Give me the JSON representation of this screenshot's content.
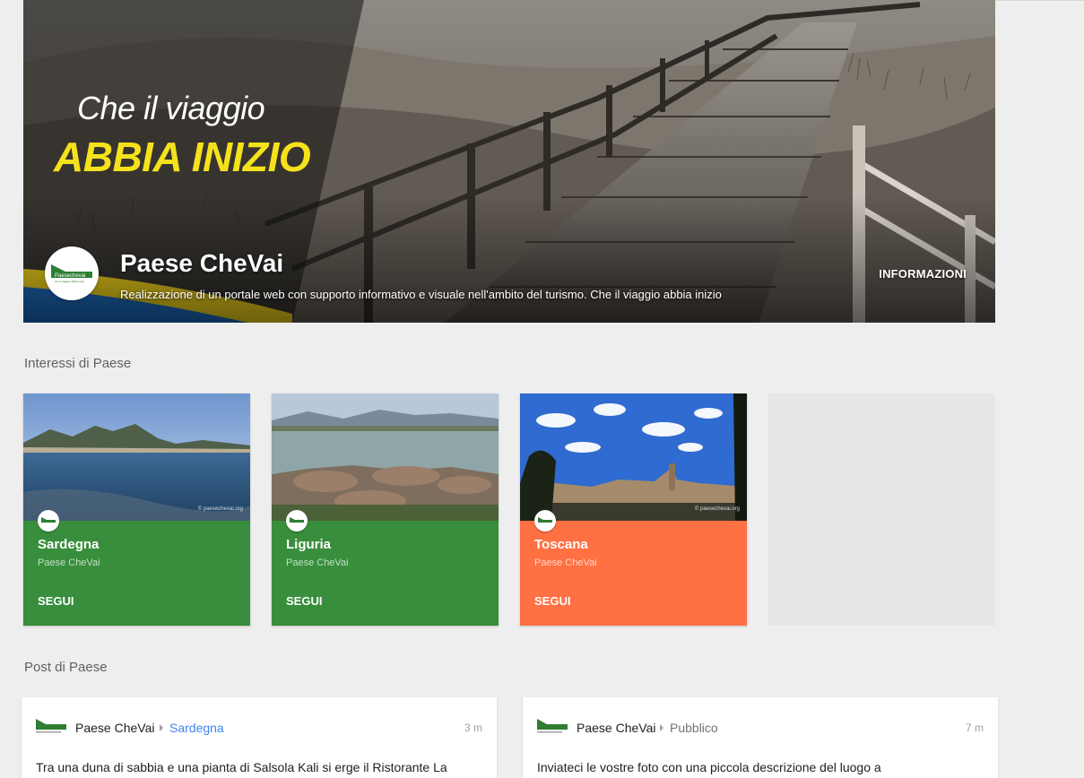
{
  "cover": {
    "tagline_line1": "Che il viaggio",
    "tagline_line2": "ABBIA INIZIO",
    "page_name": "Paese CheVai",
    "description": "Realizzazione di un portale web con supporto informativo e visuale nell'ambito del turismo. Che il viaggio abbia inizio",
    "info_button": "INFORMAZIONI",
    "logo_text": "Paesechevai",
    "logo_subtext": "che il viaggio abbia inizio"
  },
  "interests": {
    "section_title": "Interessi di Paese",
    "cards": [
      {
        "name": "Sardegna",
        "owner": "Paese CheVai",
        "follow": "SEGUI",
        "color": "#388e3c",
        "credit": "© paesechevai.org"
      },
      {
        "name": "Liguria",
        "owner": "Paese CheVai",
        "follow": "SEGUI",
        "color": "#388e3c",
        "credit": ""
      },
      {
        "name": "Toscana",
        "owner": "Paese CheVai",
        "follow": "SEGUI",
        "color": "#ff7043",
        "credit": "© paesechevai.org"
      }
    ]
  },
  "posts": {
    "section_title": "Post di Paese",
    "items": [
      {
        "author": "Paese CheVai",
        "audience": "Sardegna",
        "audience_color": "#4285f4",
        "time": "3 m",
        "text": "Tra una duna di sabbia e una pianta di Salsola Kali si erge il Ristorante La"
      },
      {
        "author": "Paese CheVai",
        "audience": "Pubblico",
        "audience_color": "#757575",
        "time": "7 m",
        "text": "Inviateci le vostre foto con una piccola descrizione del luogo a"
      }
    ]
  },
  "colors": {
    "background": "#eeeeee",
    "green": "#388e3c",
    "orange": "#ff7043",
    "tagline_yellow": "#f5e21b",
    "link_blue": "#4285f4"
  }
}
